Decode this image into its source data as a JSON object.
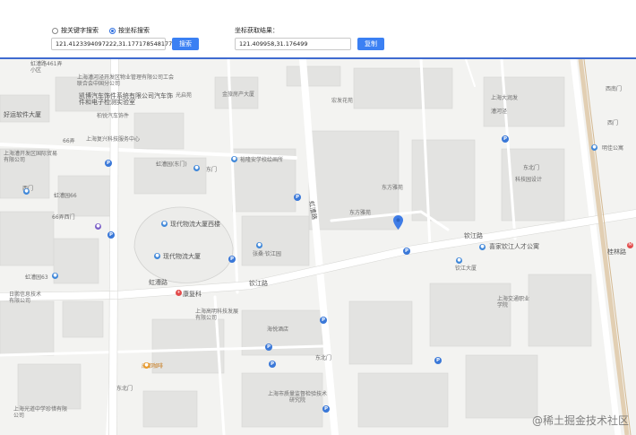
{
  "search_mode": {
    "option_keyword": "按关键字搜索",
    "option_coordinate": "按坐标搜索",
    "selected": "coordinate"
  },
  "search": {
    "value": "121.4123394097222,31.17717854817708",
    "button_label": "搜索"
  },
  "result": {
    "label": "坐标获取结果：",
    "value": "121.409958,31.176499",
    "button_label": "复制"
  },
  "colors": {
    "accent": "#3b80f3",
    "toolbar_border": "#3f6bd0",
    "marker": "#3e7ce6"
  },
  "map": {
    "road_labels": [
      "虹漕路",
      "钦江路",
      "虹漕路",
      "钦江路",
      "桂林路"
    ],
    "labels": [
      "上海漕河泾开发区物业管理有限公司工会联合会中国分公司",
      "凯博汽车饰件系统有限公司汽车饰件和电子检测实验室",
      "光启苑",
      "宏发花苑",
      "金旅房产大厦",
      "东方雅苑",
      "上海大润发",
      "漕河泾",
      "虹漕路461弄小区",
      "上海复兴科技服务中心",
      "好运软件大厦",
      "上海漕开发区国际贸易有限公司",
      "柏锐汽车饰件",
      "66弄",
      "虹漕园(东门)",
      "东门",
      "裕隆安学校绘画所",
      "虹漕园66",
      "66弄西门",
      "西门",
      "现代物流大厦西楼",
      "东方雅苑",
      "现代物流大厦",
      "张桑·钦江园",
      "虹漕园63",
      "日鹏信息技术有限公司",
      "康复科",
      "上海高明科技发展有限公司",
      "海悦酒店",
      "喜家钦江人才公寓",
      "钦江大厦",
      "上海交通职业学院",
      "成都咖啡",
      "东北门",
      "东北门",
      "上海市质量监督检验技术研究院",
      "上海光道中学珍惜有限公司",
      "明佳公寓",
      "西南门",
      "西门",
      "东北门",
      "科技园设计"
    ]
  },
  "watermark": "@稀土掘金技术社区"
}
